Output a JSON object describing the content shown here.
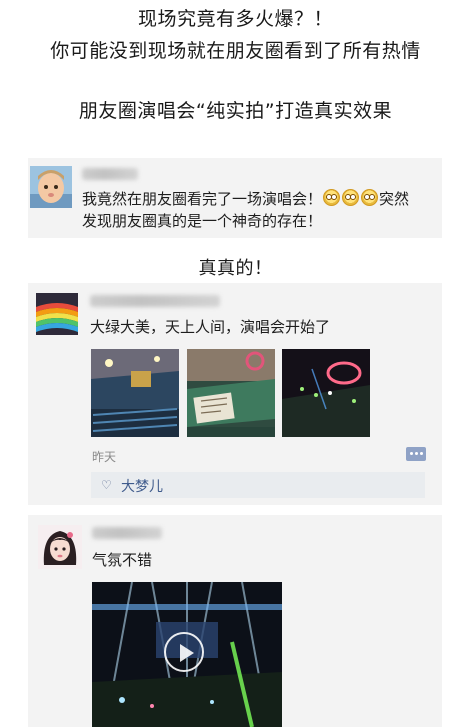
{
  "headlines": {
    "line1": "现场究竟有多火爆？！",
    "line2": "你可能没到现场就在朋友圈看到了所有热情",
    "line3": "朋友圈演唱会“纯实拍”打造真实效果"
  },
  "post1": {
    "text_line1": "我竟然在朋友圈看完了一场演唱会！",
    "text_line1_tail": "突然",
    "text_line2": "发现朋友圈真的是一个神奇的存在！",
    "emoji_icons": [
      "dizzy-face-icon",
      "dizzy-face-icon",
      "dizzy-face-icon"
    ]
  },
  "caption": "真真的！",
  "post2": {
    "text": "大绿大美，天上人间，演唱会开始了",
    "time": "昨天",
    "liker": "大梦儿",
    "like_icon": "heart-outline-icon",
    "comment_icon": "comment-bubble-icon"
  },
  "post3": {
    "text": "气氛不错",
    "video_icon": "play-icon"
  },
  "colors": {
    "card_bg": "#f3f3f3",
    "link_blue": "#3f5b8c",
    "like_bar": "#e9ecef"
  }
}
